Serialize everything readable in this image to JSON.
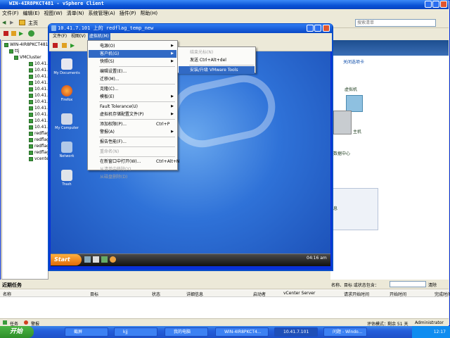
{
  "outer": {
    "title": "WIN-4IR8PKCT481 - vSphere Client",
    "menu": [
      "文件(F)",
      "编辑(E)",
      "视图(W)",
      "清单(N)",
      "系统管理(A)",
      "插件(P)",
      "帮助(H)"
    ],
    "nav_label": "主页",
    "search_placeholder": "搜索清单"
  },
  "tree": {
    "items": [
      "WIN-4IR8PKCT481",
      "ttj",
      "VMCluster",
      "10.41.",
      "10.41.",
      "10.41.",
      "10.41.",
      "10.41.",
      "10.41.",
      "10.41.",
      "10.41.",
      "10.41.",
      "10.41.",
      "10.41.",
      "redflag",
      "redflag",
      "redflag",
      "redflag",
      "vcenter"
    ]
  },
  "right_panel": {
    "close_tab": "关闭选项卡",
    "vm_label": "虚拟机",
    "host_label": "主机",
    "dc_label": "数据中心",
    "info": "息"
  },
  "console": {
    "title": "10.41.7.101 上的 redflag_temp_new",
    "menu": [
      "文件(F)",
      "视图(V)",
      "虚拟机(M)"
    ]
  },
  "vm_menu": {
    "items": [
      {
        "label": "电源(O)",
        "arrow": true,
        "disabled": false
      },
      {
        "label": "客户机(G)",
        "arrow": true,
        "disabled": false,
        "highlight": true
      },
      {
        "label": "快照(S)",
        "arrow": true,
        "disabled": false
      },
      {
        "sep": true
      },
      {
        "label": "编辑设置(E)...",
        "disabled": false
      },
      {
        "label": "迁移(M)...",
        "disabled": false
      },
      {
        "sep": true
      },
      {
        "label": "克隆(C)...",
        "disabled": false
      },
      {
        "label": "模板(E)",
        "arrow": true,
        "disabled": false
      },
      {
        "sep": true
      },
      {
        "label": "Fault Tolerance(U)",
        "arrow": true,
        "disabled": false
      },
      {
        "label": "虚拟机存储配置文件(P)",
        "arrow": true,
        "disabled": false
      },
      {
        "sep": true
      },
      {
        "label": "添加权限(P)...",
        "shortcut": "Ctrl+P",
        "disabled": false
      },
      {
        "label": "警报(A)",
        "arrow": true,
        "disabled": false
      },
      {
        "sep": true
      },
      {
        "label": "报告性能(F)...",
        "disabled": false
      },
      {
        "sep": true
      },
      {
        "label": "重命名(N)",
        "disabled": true
      },
      {
        "sep": true
      },
      {
        "label": "在新窗口中打开(W)...",
        "shortcut": "Ctrl+Alt+N",
        "disabled": false
      },
      {
        "label": "从清单中移除(Y)",
        "disabled": true
      },
      {
        "label": "从磁盘删除(D)",
        "disabled": true
      }
    ]
  },
  "guest_submenu": {
    "items": [
      {
        "label": "结束光标(N)",
        "disabled": true
      },
      {
        "label": "发送 Ctrl+Alt+del",
        "disabled": false
      },
      {
        "sep": true
      },
      {
        "label": "安装/升级 VMware Tools",
        "disabled": false,
        "highlight": true
      }
    ]
  },
  "guest_desktop": {
    "icons": [
      "My Documents",
      "Firefox",
      "My Computer",
      "Network",
      "Trash"
    ],
    "start": "Start",
    "clock": "04:16 am"
  },
  "tasks": {
    "title": "近期任务",
    "filter_label": "名称、目标 或状态包含：",
    "clear": "清除",
    "columns": [
      "名称",
      "目标",
      "状态",
      "详细信息",
      "启动者",
      "vCenter Server",
      "请求开始时间",
      "开始时间",
      "完成时间"
    ]
  },
  "status": {
    "tasks": "任务",
    "alarms": "警报",
    "eval": "评估模式：",
    "remaining": "剩余 51 天",
    "user": "Administrator"
  },
  "xp_taskbar": {
    "start": "开始",
    "buttons": [
      "截屏",
      "kjj",
      "我的电脑",
      "WIN-4IR8PKCT4...",
      "10.41.7.101",
      "问题 - Windo..."
    ],
    "clock": "12:17"
  }
}
